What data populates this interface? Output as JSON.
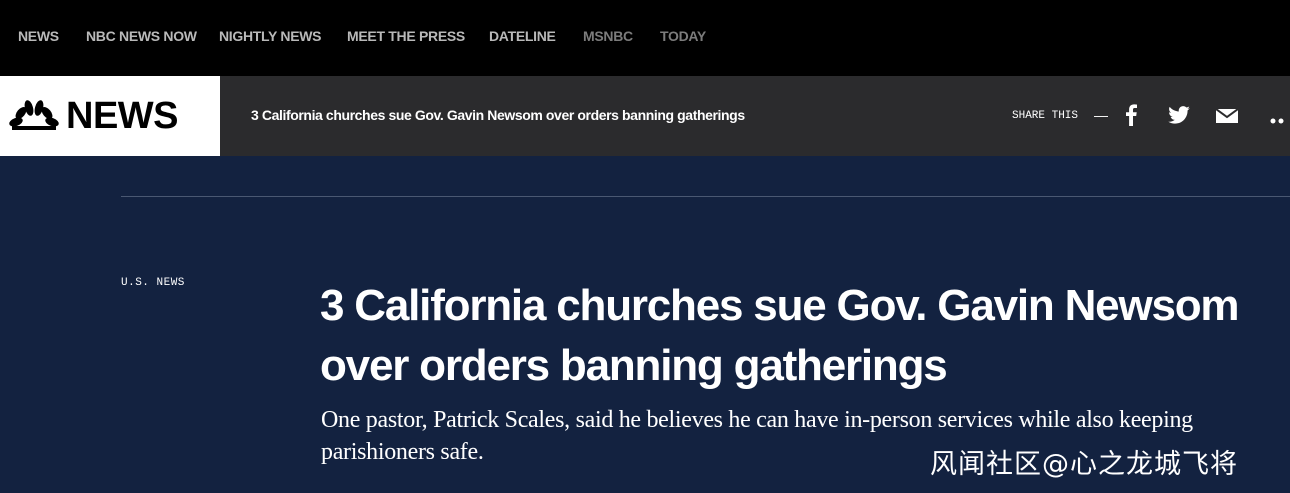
{
  "top_nav": {
    "items": [
      {
        "label": "NEWS"
      },
      {
        "label": "NBC NEWS NOW"
      },
      {
        "label": "NIGHTLY NEWS"
      },
      {
        "label": "MEET THE PRESS"
      },
      {
        "label": "DATELINE"
      },
      {
        "label": "MSNBC"
      },
      {
        "label": "TODAY"
      }
    ]
  },
  "header": {
    "logo_text": "NEWS",
    "logo_icon": "nbc-peacock-icon",
    "article_title": "3 California churches sue Gov. Gavin Newsom over orders banning gatherings",
    "share_label": "SHARE THIS",
    "share_separator": "—",
    "share_icons": [
      "facebook-icon",
      "twitter-icon",
      "email-icon",
      "more-icon"
    ]
  },
  "article": {
    "section": "U.S. NEWS",
    "headline": "3 California churches sue Gov. Gavin Newsom over orders banning gatherings",
    "dek": "One pastor, Patrick Scales, said he believes he can have in-person services while also keeping parishioners safe."
  },
  "watermark": "风闻社区@心之龙城飞将",
  "colors": {
    "top_nav_bg": "#000000",
    "header_bg": "#2b2b2d",
    "page_bg": "#132240",
    "text": "#ffffff"
  }
}
